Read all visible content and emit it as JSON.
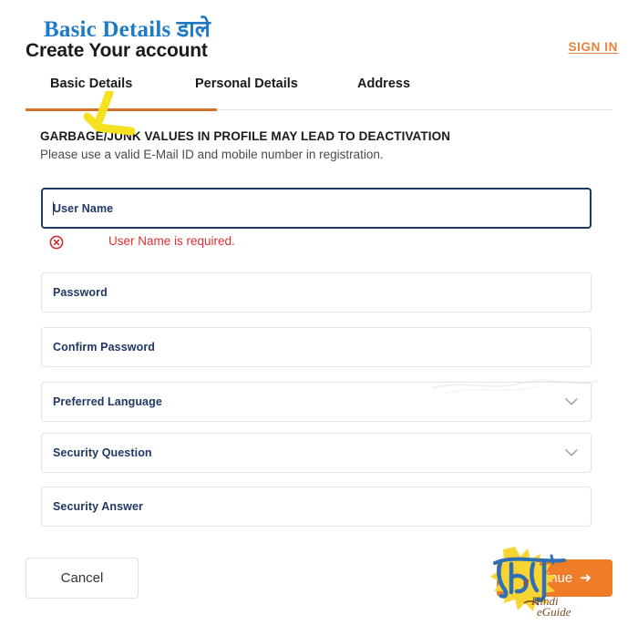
{
  "header": {
    "hindi_title": "Basic Details डाले",
    "page_title": "Create Your account",
    "signin_label": "SIGN IN"
  },
  "tabs": {
    "active_index": 0,
    "items": [
      {
        "label": "Basic Details"
      },
      {
        "label": "Personal Details"
      },
      {
        "label": "Address"
      }
    ]
  },
  "notice": {
    "warning": "GARBAGE/JUNK VALUES IN PROFILE MAY LEAD TO DEACTIVATION",
    "hint": "Please use a valid E-Mail ID and mobile number in registration."
  },
  "form": {
    "fields": [
      {
        "label": "User Name",
        "type": "text",
        "value": "",
        "focused": true
      },
      {
        "label": "Password",
        "type": "password",
        "value": "",
        "focused": false
      },
      {
        "label": "Confirm Password",
        "type": "password",
        "value": "",
        "focused": false
      },
      {
        "label": "Preferred Language",
        "type": "select",
        "value": "",
        "focused": false
      },
      {
        "label": "Security Question",
        "type": "select",
        "value": "",
        "focused": false
      },
      {
        "label": "Security Answer",
        "type": "text",
        "value": "",
        "focused": false
      }
    ],
    "error": {
      "icon": "error-circle-x-icon",
      "message": "User Name is required."
    }
  },
  "actions": {
    "cancel_label": "Cancel",
    "continue_label": "Continue",
    "continue_arrow": "➜"
  },
  "watermark": {
    "devanagari": "हिन्दी",
    "brand_line1": "Hindi",
    "brand_line2": "eGuide"
  },
  "colors": {
    "accent_orange": "#f07c28",
    "tab_underline": "#d4722c",
    "signin_orange": "#e8803a",
    "label_navy": "#1f3864",
    "error_red": "#e03030",
    "hindi_blue": "#1f7ac4",
    "marker_yellow": "#f5e11f",
    "watermark_yellow": "#f9d533",
    "watermark_blue": "#2f6fb5"
  }
}
